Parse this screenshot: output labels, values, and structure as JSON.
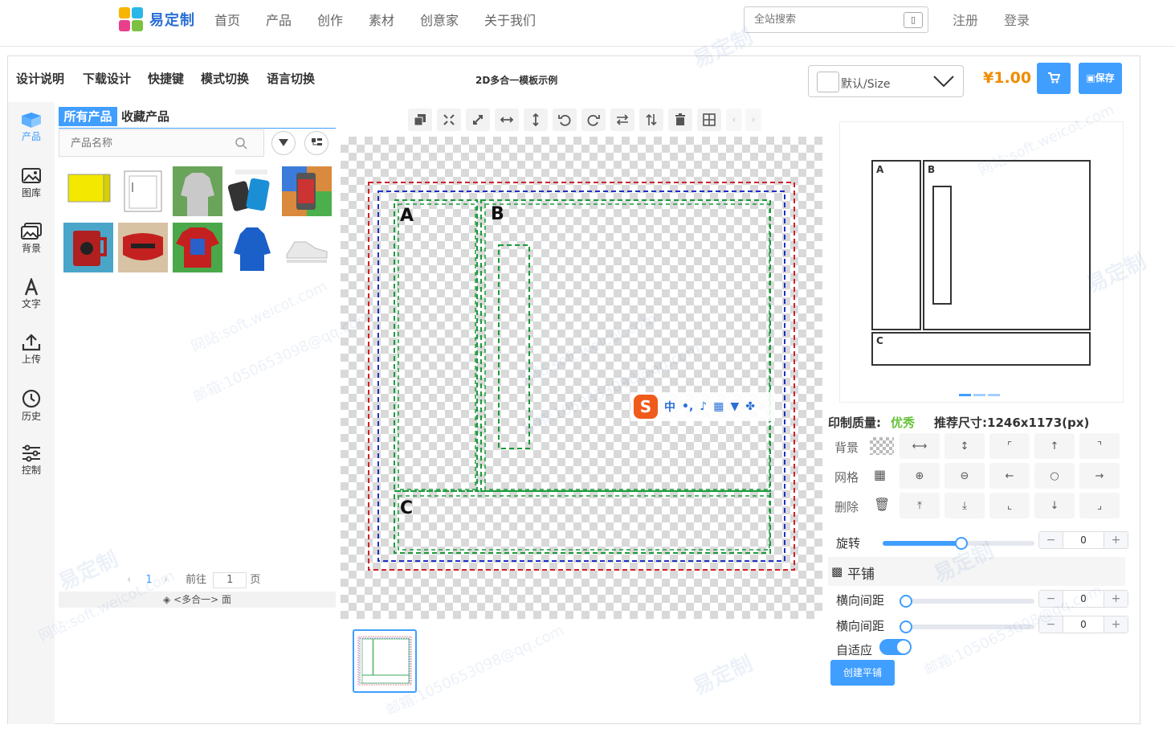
{
  "site": {
    "logo_text": "易定制",
    "nav": [
      "首页",
      "产品",
      "创作",
      "素材",
      "创意家",
      "关于我们"
    ],
    "search_placeholder": "全站搜索",
    "register": "注册",
    "login": "登录"
  },
  "header": {
    "menu": [
      "设计说明",
      "下载设计",
      "快捷键",
      "模式切换",
      "语言切换"
    ],
    "template_title": "2D多合一模板示例",
    "size_select": "默认/Size",
    "price": "¥1.00",
    "save_label": "保存"
  },
  "sidebar": {
    "items": [
      {
        "label": "产品",
        "icon": "box-icon"
      },
      {
        "label": "图库",
        "icon": "gallery-icon"
      },
      {
        "label": "背景",
        "icon": "background-icon"
      },
      {
        "label": "文字",
        "icon": "text-icon"
      },
      {
        "label": "上传",
        "icon": "upload-icon"
      },
      {
        "label": "历史",
        "icon": "history-icon"
      },
      {
        "label": "控制",
        "icon": "control-icon"
      }
    ]
  },
  "products": {
    "tabs": [
      "所有产品",
      "收藏产品"
    ],
    "search_placeholder": "产品名称",
    "pager": {
      "current": "1",
      "goto_label": "前往",
      "goto_value": "1",
      "page_unit": "页"
    },
    "face_label": "<多合一> 面"
  },
  "canvas": {
    "zones": [
      "A",
      "B",
      "C"
    ],
    "ime_label": "中"
  },
  "preview": {
    "zones": [
      "A",
      "B",
      "C"
    ]
  },
  "quality": {
    "label": "印制质量:",
    "value": "优秀",
    "recommend": "推荐尺寸:1246x1173(px)"
  },
  "controls": {
    "background_label": "背景",
    "grid_label": "网格",
    "delete_label": "删除",
    "rotate_label": "旋转",
    "rotate_value": "0",
    "rotate_fraction": 0.52,
    "tile_title": "平铺",
    "h_spacing_label": "横向间距",
    "h_spacing_value": "0",
    "v_spacing_label": "横向间距",
    "v_spacing_value": "0",
    "adaptive_label": "自适应",
    "create_tile": "创建平铺"
  },
  "watermarks": [
    "易定制",
    "网站:soft.weicot.com",
    "邮箱:1050653098@qq.com"
  ],
  "colors": {
    "accent": "#409eff",
    "price": "#f08c00",
    "good": "#67c23a"
  }
}
